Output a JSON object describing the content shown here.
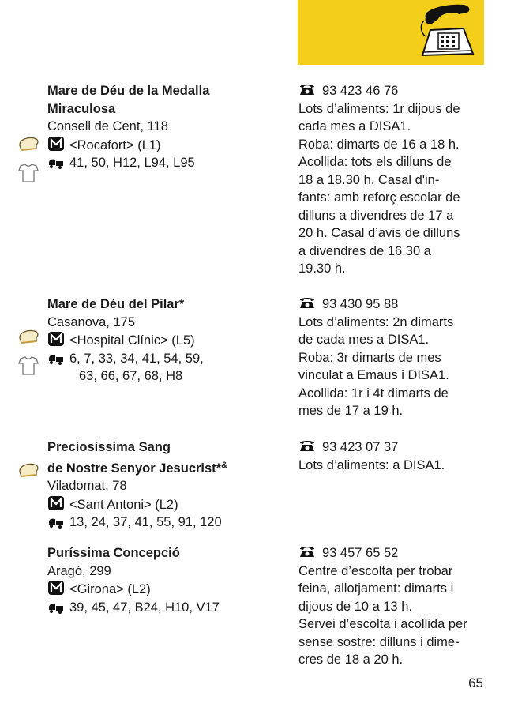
{
  "header": {
    "illustration": "telephone-fax-icon",
    "accent_color": "#f3cf1b"
  },
  "entries": [
    {
      "name": [
        "Mare de Déu de la Medalla",
        "Miraculosa"
      ],
      "address": "Consell de Cent, 118",
      "metro": "<Rocafort> (L1)",
      "bus": [
        "41, 50, H12, L94, L95"
      ],
      "side_icons": [
        "bread-icon",
        "tshirt-icon"
      ],
      "phone": "93 423 46 76",
      "details": [
        "Lots d’aliments: 1r dijous de",
        "cada mes a DISA1.",
        "Roba: dimarts de 16 a 18 h.",
        "Acollida: tots els dilluns de",
        "18 a 18.30 h. Casal d'in-",
        "fants: amb reforç escolar de",
        "dilluns a divendres de 17 a",
        "20 h. Casal d’avis de dilluns",
        "a divendres de 16.30 a",
        "19.30 h."
      ]
    },
    {
      "name": [
        "Mare de Déu del Pilar*"
      ],
      "address": "Casanova, 175",
      "metro": "<Hospital Clínic> (L5)",
      "bus": [
        "6, 7, 33, 34, 41, 54, 59,",
        "63, 66, 67, 68, H8"
      ],
      "side_icons": [
        "bread-icon",
        "tshirt-icon"
      ],
      "phone": "93 430 95 88",
      "details": [
        "Lots d’aliments: 2n dimarts",
        "de cada mes a DISA1.",
        "Roba: 3r dimarts de mes",
        "vinculat a Emaus i DISA1.",
        "Acollida: 1r i 4t dimarts de",
        "mes de 17 a 19 h."
      ]
    },
    {
      "name": [
        "Preciosíssima Sang",
        "de Nostre Senyor Jesucrist*"
      ],
      "name_suffix": "&",
      "address": "Viladomat, 78",
      "metro": "<Sant Antoni> (L2)",
      "bus": [
        "13, 24, 37, 41, 55, 91, 120"
      ],
      "side_icons": [
        "bread-icon"
      ],
      "phone": "93 423 07 37",
      "details": [
        "Lots d’aliments: a DISA1."
      ]
    },
    {
      "name": [
        "Puríssima Concepció"
      ],
      "address": "Aragó, 299",
      "metro": "<Girona> (L2)",
      "bus": [
        "39, 45, 47, B24, H10, V17"
      ],
      "side_icons": [],
      "phone": "93 457 65 52",
      "details": [
        "Centre d’escolta per trobar",
        "feina, allotjament: dimarts i",
        "dijous de 10 a 13 h.",
        "Servei d’escolta i acollida per",
        "sense sostre: dilluns i dime-",
        "cres de 18 a 20 h."
      ]
    }
  ],
  "page_number": "65"
}
